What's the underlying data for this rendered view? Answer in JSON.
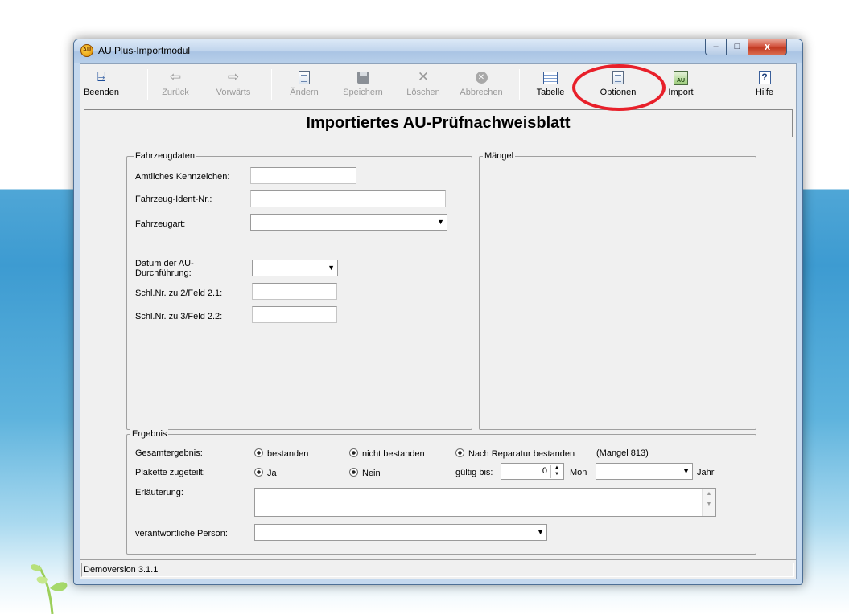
{
  "window": {
    "title": "AU Plus-Importmodul",
    "controls": {
      "minimize": "–",
      "maximize": "□",
      "close": "x"
    }
  },
  "toolbar": {
    "items": [
      {
        "label": "Beenden",
        "icon": "exit-door-icon",
        "enabled": true
      },
      {
        "label": "Zurück",
        "icon": "arrow-left-icon",
        "enabled": false
      },
      {
        "label": "Vorwärts",
        "icon": "arrow-right-icon",
        "enabled": false
      },
      {
        "label": "Ändern",
        "icon": "edit-icon",
        "enabled": false
      },
      {
        "label": "Speichern",
        "icon": "save-icon",
        "enabled": false
      },
      {
        "label": "Löschen",
        "icon": "delete-icon",
        "enabled": false
      },
      {
        "label": "Abbrechen",
        "icon": "cancel-icon",
        "enabled": false
      },
      {
        "label": "Tabelle",
        "icon": "table-icon",
        "enabled": true
      },
      {
        "label": "Optionen",
        "icon": "options-icon",
        "enabled": true
      },
      {
        "label": "Import",
        "icon": "import-icon",
        "icon_text": "AU",
        "enabled": true
      },
      {
        "label": "Hilfe",
        "icon": "help-icon",
        "icon_text": "?",
        "enabled": true
      }
    ]
  },
  "heading": "Importiertes AU-Prüfnachweisblatt",
  "vehicle": {
    "legend": "Fahrzeugdaten",
    "kennzeichen_label": "Amtliches Kennzeichen:",
    "ident_label": "Fahrzeug-Ident-Nr.:",
    "art_label": "Fahrzeugart:",
    "datum_label_1": "Datum der AU-",
    "datum_label_2": "Durchführung:",
    "schl21_label": "Schl.Nr. zu 2/Feld 2.1:",
    "schl22_label": "Schl.Nr. zu 3/Feld 2.2:"
  },
  "maengel": {
    "legend": "Mängel"
  },
  "result": {
    "legend": "Ergebnis",
    "gesamt_label": "Gesamtergebnis:",
    "opt_bestanden": "bestanden",
    "opt_nicht_bestanden": "nicht bestanden",
    "opt_nach_reparatur": "Nach Reparatur bestanden",
    "mangel_note": "(Mangel 813)",
    "plakette_label": "Plakette zugeteilt:",
    "opt_ja": "Ja",
    "opt_nein": "Nein",
    "gueltig_label": "gültig bis:",
    "months_value": "0",
    "mon_label": "Mon",
    "jahr_label": "Jahr",
    "erlaeuterung_label": "Erläuterung:",
    "person_label": "verantwortliche Person:"
  },
  "status": {
    "text": "Demoversion 3.1.1"
  },
  "colors": {
    "highlight_ellipse": "#e8202a",
    "title_blue": "#bfd4ec",
    "close_red": "#c23a22"
  }
}
